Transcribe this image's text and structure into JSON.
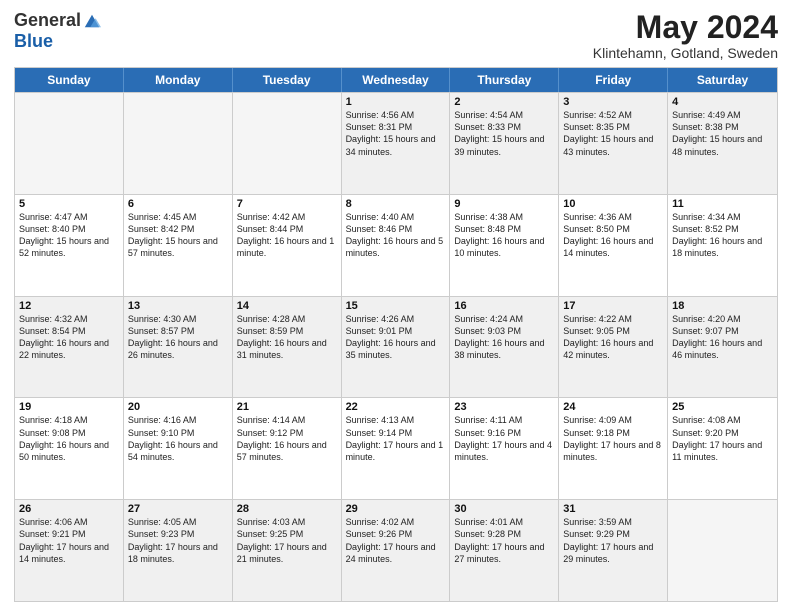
{
  "header": {
    "logo_general": "General",
    "logo_blue": "Blue",
    "month_title": "May 2024",
    "subtitle": "Klintehamn, Gotland, Sweden"
  },
  "days": [
    "Sunday",
    "Monday",
    "Tuesday",
    "Wednesday",
    "Thursday",
    "Friday",
    "Saturday"
  ],
  "weeks": [
    [
      {
        "day": "",
        "empty": true
      },
      {
        "day": "",
        "empty": true
      },
      {
        "day": "",
        "empty": true
      },
      {
        "day": "1",
        "sunrise": "4:56 AM",
        "sunset": "8:31 PM",
        "daylight": "15 hours and 34 minutes."
      },
      {
        "day": "2",
        "sunrise": "4:54 AM",
        "sunset": "8:33 PM",
        "daylight": "15 hours and 39 minutes."
      },
      {
        "day": "3",
        "sunrise": "4:52 AM",
        "sunset": "8:35 PM",
        "daylight": "15 hours and 43 minutes."
      },
      {
        "day": "4",
        "sunrise": "4:49 AM",
        "sunset": "8:38 PM",
        "daylight": "15 hours and 48 minutes."
      }
    ],
    [
      {
        "day": "5",
        "sunrise": "4:47 AM",
        "sunset": "8:40 PM",
        "daylight": "15 hours and 52 minutes."
      },
      {
        "day": "6",
        "sunrise": "4:45 AM",
        "sunset": "8:42 PM",
        "daylight": "15 hours and 57 minutes."
      },
      {
        "day": "7",
        "sunrise": "4:42 AM",
        "sunset": "8:44 PM",
        "daylight": "16 hours and 1 minute."
      },
      {
        "day": "8",
        "sunrise": "4:40 AM",
        "sunset": "8:46 PM",
        "daylight": "16 hours and 5 minutes."
      },
      {
        "day": "9",
        "sunrise": "4:38 AM",
        "sunset": "8:48 PM",
        "daylight": "16 hours and 10 minutes."
      },
      {
        "day": "10",
        "sunrise": "4:36 AM",
        "sunset": "8:50 PM",
        "daylight": "16 hours and 14 minutes."
      },
      {
        "day": "11",
        "sunrise": "4:34 AM",
        "sunset": "8:52 PM",
        "daylight": "16 hours and 18 minutes."
      }
    ],
    [
      {
        "day": "12",
        "sunrise": "4:32 AM",
        "sunset": "8:54 PM",
        "daylight": "16 hours and 22 minutes."
      },
      {
        "day": "13",
        "sunrise": "4:30 AM",
        "sunset": "8:57 PM",
        "daylight": "16 hours and 26 minutes."
      },
      {
        "day": "14",
        "sunrise": "4:28 AM",
        "sunset": "8:59 PM",
        "daylight": "16 hours and 31 minutes."
      },
      {
        "day": "15",
        "sunrise": "4:26 AM",
        "sunset": "9:01 PM",
        "daylight": "16 hours and 35 minutes."
      },
      {
        "day": "16",
        "sunrise": "4:24 AM",
        "sunset": "9:03 PM",
        "daylight": "16 hours and 38 minutes."
      },
      {
        "day": "17",
        "sunrise": "4:22 AM",
        "sunset": "9:05 PM",
        "daylight": "16 hours and 42 minutes."
      },
      {
        "day": "18",
        "sunrise": "4:20 AM",
        "sunset": "9:07 PM",
        "daylight": "16 hours and 46 minutes."
      }
    ],
    [
      {
        "day": "19",
        "sunrise": "4:18 AM",
        "sunset": "9:08 PM",
        "daylight": "16 hours and 50 minutes."
      },
      {
        "day": "20",
        "sunrise": "4:16 AM",
        "sunset": "9:10 PM",
        "daylight": "16 hours and 54 minutes."
      },
      {
        "day": "21",
        "sunrise": "4:14 AM",
        "sunset": "9:12 PM",
        "daylight": "16 hours and 57 minutes."
      },
      {
        "day": "22",
        "sunrise": "4:13 AM",
        "sunset": "9:14 PM",
        "daylight": "17 hours and 1 minute."
      },
      {
        "day": "23",
        "sunrise": "4:11 AM",
        "sunset": "9:16 PM",
        "daylight": "17 hours and 4 minutes."
      },
      {
        "day": "24",
        "sunrise": "4:09 AM",
        "sunset": "9:18 PM",
        "daylight": "17 hours and 8 minutes."
      },
      {
        "day": "25",
        "sunrise": "4:08 AM",
        "sunset": "9:20 PM",
        "daylight": "17 hours and 11 minutes."
      }
    ],
    [
      {
        "day": "26",
        "sunrise": "4:06 AM",
        "sunset": "9:21 PM",
        "daylight": "17 hours and 14 minutes."
      },
      {
        "day": "27",
        "sunrise": "4:05 AM",
        "sunset": "9:23 PM",
        "daylight": "17 hours and 18 minutes."
      },
      {
        "day": "28",
        "sunrise": "4:03 AM",
        "sunset": "9:25 PM",
        "daylight": "17 hours and 21 minutes."
      },
      {
        "day": "29",
        "sunrise": "4:02 AM",
        "sunset": "9:26 PM",
        "daylight": "17 hours and 24 minutes."
      },
      {
        "day": "30",
        "sunrise": "4:01 AM",
        "sunset": "9:28 PM",
        "daylight": "17 hours and 27 minutes."
      },
      {
        "day": "31",
        "sunrise": "3:59 AM",
        "sunset": "9:29 PM",
        "daylight": "17 hours and 29 minutes."
      },
      {
        "day": "",
        "empty": true
      }
    ]
  ]
}
